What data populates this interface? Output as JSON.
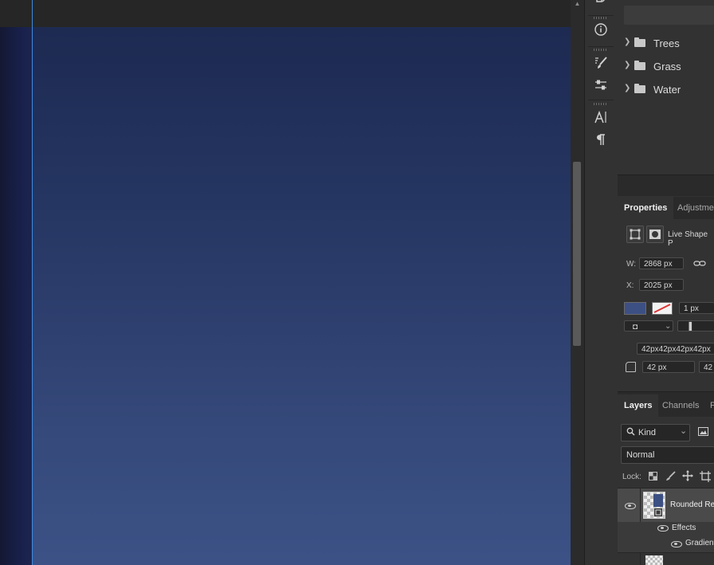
{
  "groups": [
    {
      "label": "Trees"
    },
    {
      "label": "Grass"
    },
    {
      "label": "Water"
    }
  ],
  "properties": {
    "tabs": [
      "Properties",
      "Adjustme"
    ],
    "live_shape_label": "Live Shape P",
    "w_label": "W:",
    "w_value": "2868 px",
    "x_label": "X:",
    "x_value": "2025 px",
    "fill_color": "#3d5084",
    "stroke_width": "1 px",
    "corner_radii": "42px42px42px42px",
    "corner_tl": "42 px",
    "corner_tr": "42"
  },
  "layers": {
    "tabs": [
      "Layers",
      "Channels",
      "P"
    ],
    "filter_kind": "Kind",
    "blend_mode": "Normal",
    "lock_label": "Lock:",
    "selected_layer": "Rounded Re",
    "effects_label": "Effects",
    "effect_item": "Gradient"
  },
  "colors": {
    "guide": "#3d8be0",
    "canvas_top": "#1d2a52",
    "canvas_bottom": "#3c5286"
  }
}
